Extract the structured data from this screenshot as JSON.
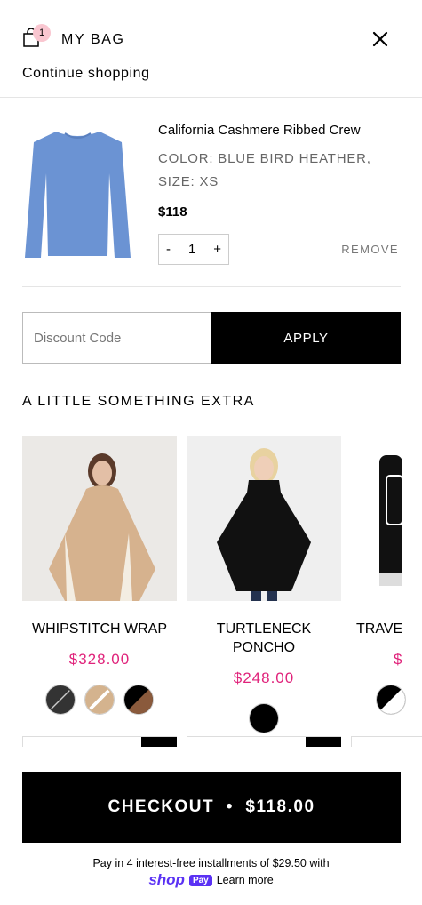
{
  "header": {
    "title": "MY BAG",
    "bag_count": "1",
    "continue_label": "Continue shopping"
  },
  "cart_item": {
    "name": "California Cashmere Ribbed Crew",
    "color": "COLOR: BLUE BIRD HEATHER,",
    "size": "SIZE: XS",
    "price": "$118",
    "quantity": "1",
    "minus": "-",
    "plus": "+",
    "remove_label": "REMOVE"
  },
  "discount": {
    "placeholder": "Discount Code",
    "apply_label": "APPLY"
  },
  "extras": {
    "title": "A LITTLE SOMETHING EXTRA",
    "products": [
      {
        "name": "WHIPSTITCH WRAP",
        "price": "$328.00"
      },
      {
        "name": "TURTLENECK PONCHO",
        "price": "$248.00"
      },
      {
        "name": "TRAVE",
        "price": "$"
      }
    ]
  },
  "checkout": {
    "label": "CHECKOUT  •  $118.00"
  },
  "installments": {
    "text": "Pay in 4 interest-free installments of $29.50 with",
    "shop_logo": "shop",
    "pay_badge": "Pay",
    "learn_more": "Learn more"
  },
  "colors": {
    "accent_price": "#e0237b",
    "sweater_blue": "#6b93d3",
    "shop_purple": "#5a31f4"
  }
}
